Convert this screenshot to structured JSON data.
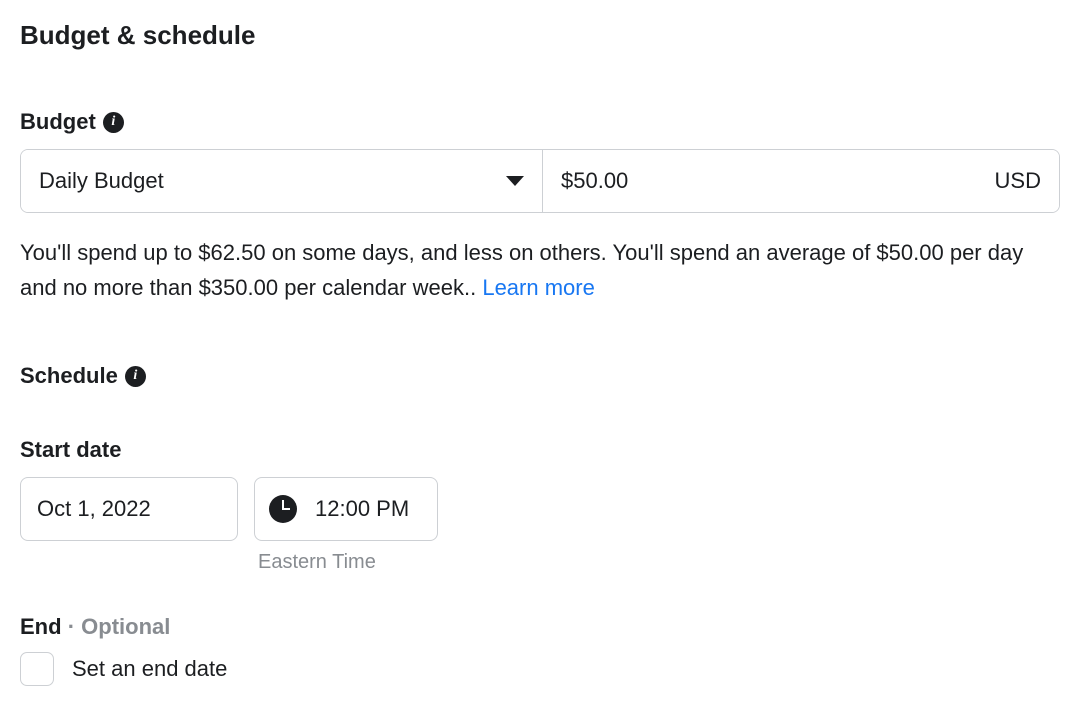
{
  "section": {
    "title": "Budget & schedule"
  },
  "budget": {
    "label": "Budget",
    "type_selected": "Daily Budget",
    "amount_value": "$50.00",
    "currency": "USD",
    "helper_text": "You'll spend up to $62.50 on some days, and less on others. You'll spend an average of $50.00 per day and no more than $350.00 per calendar week..",
    "learn_more": "Learn more"
  },
  "schedule": {
    "label": "Schedule",
    "start": {
      "label": "Start date",
      "date": "Oct 1, 2022",
      "time": "12:00 PM",
      "timezone": "Eastern Time"
    },
    "end": {
      "label": "End",
      "optional": "Optional",
      "checkbox_label": "Set an end date"
    }
  }
}
